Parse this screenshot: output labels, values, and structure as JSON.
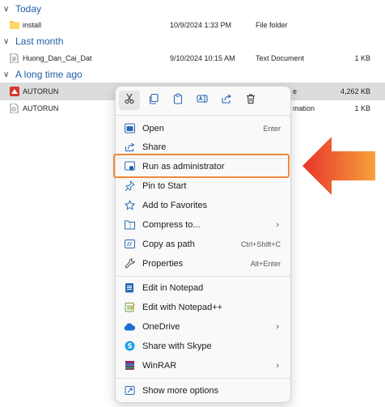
{
  "groups": {
    "today": "Today",
    "last_month": "Last month",
    "long_ago": "A long time ago"
  },
  "files": [
    {
      "name": "install",
      "date": "10/9/2024 1:33 PM",
      "type": "File folder",
      "size": ""
    },
    {
      "name": "Huong_Dan_Cai_Dat",
      "date": "9/10/2024 10:15 AM",
      "type": "Text Document",
      "size": "1 KB"
    },
    {
      "name": "AUTORUN",
      "date": "",
      "type": "e",
      "size": "4,262 KB"
    },
    {
      "name": "AUTORUN",
      "date": "",
      "type": "mation",
      "size": "1 KB"
    }
  ],
  "toolbar": {
    "icons": [
      "scissors-icon",
      "copy-icon",
      "paste-icon",
      "rename-icon",
      "share-icon",
      "delete-icon"
    ]
  },
  "menu": {
    "items": [
      {
        "label": "Open",
        "shortcut": "Enter"
      },
      {
        "label": "Share",
        "shortcut": ""
      },
      {
        "label": "Run as administrator",
        "shortcut": ""
      },
      {
        "label": "Pin to Start",
        "shortcut": ""
      },
      {
        "label": "Add to Favorites",
        "shortcut": ""
      },
      {
        "label": "Compress to...",
        "shortcut": "›"
      },
      {
        "label": "Copy as path",
        "shortcut": "Ctrl+Shift+C"
      },
      {
        "label": "Properties",
        "shortcut": "Alt+Enter"
      },
      {
        "label": "Edit in Notepad",
        "shortcut": ""
      },
      {
        "label": "Edit with Notepad++",
        "shortcut": ""
      },
      {
        "label": "OneDrive",
        "shortcut": "›"
      },
      {
        "label": "Share with Skype",
        "shortcut": ""
      },
      {
        "label": "WinRAR",
        "shortcut": "›"
      },
      {
        "label": "Show more options",
        "shortcut": ""
      }
    ]
  },
  "colors": {
    "highlight_border": "#f08a3c",
    "arrow_start": "#f7a23b",
    "arrow_end": "#e8332a",
    "group_header": "#1f5fa8"
  }
}
